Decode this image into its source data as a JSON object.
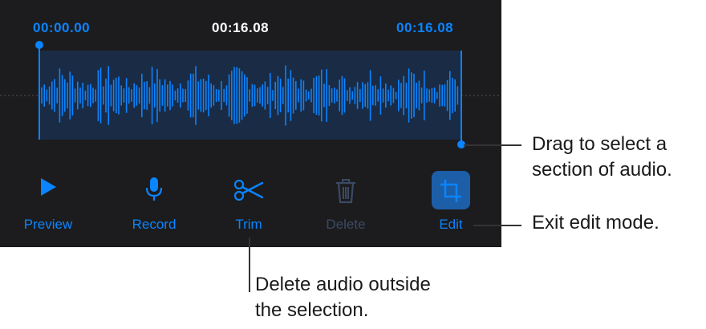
{
  "times": {
    "start": "00:00.00",
    "current": "00:16.08",
    "end": "00:16.08"
  },
  "toolbar": {
    "preview_label": "Preview",
    "record_label": "Record",
    "trim_label": "Trim",
    "delete_label": "Delete",
    "edit_label": "Edit"
  },
  "callouts": {
    "drag_line1": "Drag to select a",
    "drag_line2": "section of audio.",
    "exit": "Exit edit mode.",
    "trim_line1": "Delete audio outside",
    "trim_line2": "the selection."
  },
  "colors": {
    "accent": "#0a84ff",
    "panel_bg": "#1c1c1e",
    "selection_bg": "#1a2b45",
    "disabled": "#3a4a64"
  },
  "icons": {
    "preview": "play-icon",
    "record": "microphone-icon",
    "trim": "scissors-icon",
    "delete": "trash-icon",
    "edit": "crop-icon"
  }
}
